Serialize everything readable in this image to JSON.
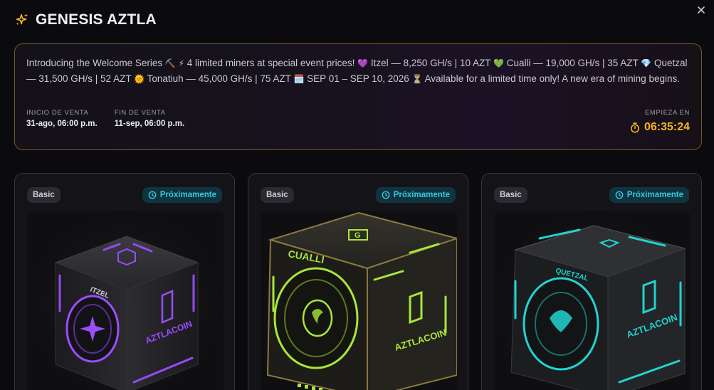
{
  "header": {
    "title": "GENESIS AZTLA",
    "icon": "sparkles-icon"
  },
  "banner": {
    "description": {
      "p1": "Introducing the Welcome Series",
      "e1": "⛏️",
      "e2": "⚡",
      "p2": "4 limited miners at special event prices!",
      "e3": "💜",
      "p3": "Itzel — 8,250 GH/s | 10 AZT",
      "e4": "💚",
      "p4": "Cualli — 19,000 GH/s | 35 AZT",
      "e5": "💎",
      "p5": "Quetzal — 31,500 GH/s | 52 AZT",
      "e6": "🌞",
      "p6": "Tonatiuh — 45,000 GH/s | 75 AZT",
      "e7": "🗓️",
      "p7": "SEP 01 – SEP 10, 2026",
      "e8": "⏳",
      "p8": "Available for a limited time only! A new era of mining begins."
    },
    "sale_start_label": "INICIO DE VENTA",
    "sale_start_value": "31-ago, 06:00 p.m.",
    "sale_end_label": "FIN DE VENTA",
    "sale_end_value": "11-sep, 06:00 p.m.",
    "countdown_label": "EMPIEZA EN",
    "countdown_value": "06:35:24"
  },
  "cards": [
    {
      "tier": "Basic",
      "status": "Próximamente",
      "name": "ITZEL",
      "brand": "AZTLACOIN",
      "accent": "#9b4dff"
    },
    {
      "tier": "Basic",
      "status": "Próximamente",
      "name": "CUALLI",
      "brand": "AZTLACOIN",
      "accent": "#a8e63a"
    },
    {
      "tier": "Basic",
      "status": "Próximamente",
      "name": "QUETZAL",
      "brand": "AZTLACOIN",
      "accent": "#22d3d0"
    }
  ],
  "colors": {
    "timer": "#f5b520",
    "status_badge": "#39c6dd",
    "banner_border": "#6e5a24"
  }
}
